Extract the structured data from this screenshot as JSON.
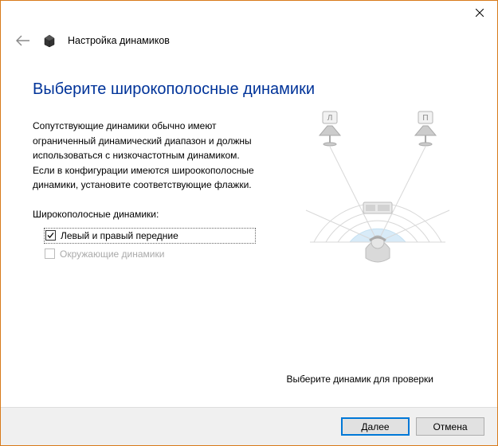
{
  "window": {
    "header_title": "Настройка динамиков"
  },
  "main": {
    "heading": "Выберите широкополосные динамики",
    "description": "Сопутствующие динамики обычно имеют ограниченный динамический диапазон и должны использоваться с низкочастотным динамиком.  Если в конфигурации имеются широокополосные динамики, установите соответствующие флажки.",
    "section_label": "Широкополосные динамики:",
    "options": {
      "front": {
        "label": "Левый и правый передние",
        "checked": true,
        "enabled": true
      },
      "surround": {
        "label": "Окружающие динамики",
        "checked": false,
        "enabled": false
      }
    },
    "hint": "Выберите динамик для проверки",
    "diagram": {
      "left_speaker_label": "Л",
      "right_speaker_label": "П"
    }
  },
  "footer": {
    "next": "Далее",
    "cancel": "Отмена"
  }
}
